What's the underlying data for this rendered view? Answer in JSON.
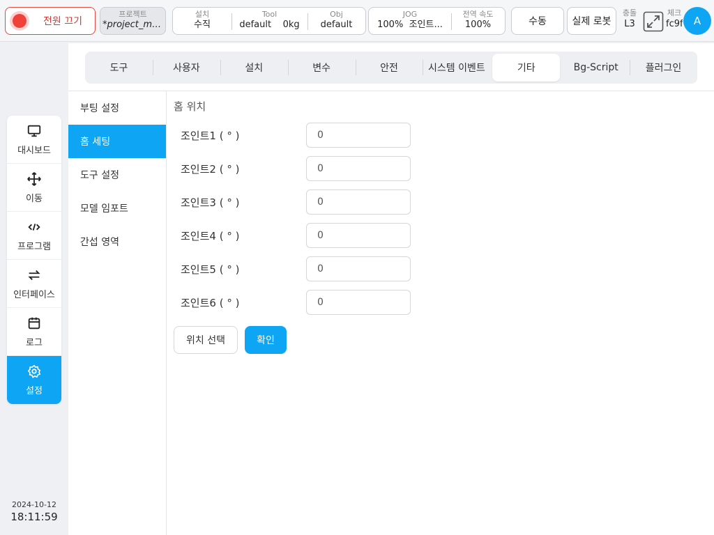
{
  "topbar": {
    "power_label": "전원 끄기",
    "project": {
      "label": "프로젝트",
      "value": "*project_mo..."
    },
    "install": {
      "label": "설치",
      "value": "수직"
    },
    "tool": {
      "label": "Tool",
      "value": "default",
      "weight": "0kg"
    },
    "obj": {
      "label": "Obj",
      "value": "default"
    },
    "jog": {
      "label": "JOG",
      "value": "100%",
      "mode": "조인트..."
    },
    "global_speed": {
      "label": "전역 속도",
      "value": "100%"
    },
    "manual_label": "수동",
    "real_robot_label": "실제 로봇",
    "collision": {
      "label": "충돌",
      "value": "L3"
    },
    "check": {
      "label": "체크",
      "value": "fc9f"
    },
    "avatar": "A"
  },
  "nav": {
    "items": [
      {
        "label": "대시보드",
        "icon": "monitor-icon"
      },
      {
        "label": "이동",
        "icon": "move-icon"
      },
      {
        "label": "프로그램",
        "icon": "code-icon"
      },
      {
        "label": "인터페이스",
        "icon": "swap-icon"
      },
      {
        "label": "로그",
        "icon": "calendar-icon"
      },
      {
        "label": "설정",
        "icon": "gear-icon"
      }
    ]
  },
  "clock": {
    "date": "2024-10-12",
    "time": "18:11:59"
  },
  "tabs": [
    "도구",
    "사용자",
    "설치",
    "변수",
    "안전",
    "시스템 이벤트",
    "기타",
    "Bg-Script",
    "플러그인"
  ],
  "subnav": [
    "부팅 설정",
    "홈 세팅",
    "도구 설정",
    "모델 임포트",
    "간섭 영역"
  ],
  "home": {
    "title": "홈 위치",
    "joints": [
      {
        "label": "조인트1 ( ° )",
        "value": "0"
      },
      {
        "label": "조인트2 ( ° )",
        "value": "0"
      },
      {
        "label": "조인트3 ( ° )",
        "value": "0"
      },
      {
        "label": "조인트4 ( ° )",
        "value": "0"
      },
      {
        "label": "조인트5 ( ° )",
        "value": "0"
      },
      {
        "label": "조인트6 ( ° )",
        "value": "0"
      }
    ],
    "select_label": "위치 선택",
    "confirm_label": "확인"
  },
  "colors": {
    "accent": "#0ea5f5",
    "power": "#e5483f"
  }
}
